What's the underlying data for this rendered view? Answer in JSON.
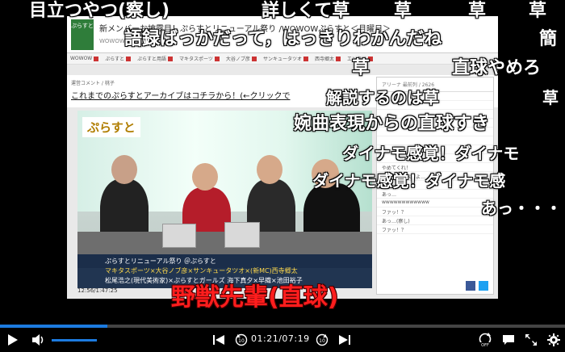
{
  "page": {
    "headline": "新メンバーお披露目！ぷらすとリニューアル祭り /WOWOWぷらすと＜月曜日＞",
    "site_logo": "ぷらすと",
    "subline": "WOWOWぷらすと",
    "nav": [
      "WOWOW",
      "ぷらすと",
      "ぷらすと用語",
      "マキタスポーツ",
      "大谷ノブ彦",
      "サンキュータツオ",
      "西寺郷太",
      "エンタメ"
    ],
    "ops_label": "運営コメント / 桃子",
    "archive_link": "これまでのぷらすとアーカイブはコチラから！(←クリックで",
    "show_logo": "ぷらすと",
    "caption_line1": "ぷらすとリニューアル祭り",
    "caption_line1b": "＠ぷらすと",
    "caption_line2": "マキタスポーツ×大谷ノブ彦×サンキュータツオ×(新MC)西寺郷太",
    "caption_line3": "松尾浩之(現代美術家)×ぷらすとガールズ 海下真夕×早織×池田裕子",
    "timecode": "12:56/1:47:25",
    "chat_header": "アリーナ 最前列 / 2626",
    "chat_lines": [
      "",
      "",
      "",
      "",
      "",
      "",
      "",
      "",
      "やめてくれ！",
      "やべぇよやべぇよ…",
      "ファッ！？",
      "あっ…",
      "wwwwwwwwwwww",
      "ファッ！？",
      "あっ…(察し)",
      "ファッ！？"
    ]
  },
  "comments": [
    {
      "text": "目立つやつ(察し)",
      "cls": "c26"
    },
    {
      "text": "詳しくて草",
      "cls": "c26"
    },
    {
      "text": "草",
      "cls": "c26"
    },
    {
      "text": "草",
      "cls": "c26"
    },
    {
      "text": "草",
      "cls": "c26"
    },
    {
      "text": "語録ばっかだって，はっきりわかんだね",
      "cls": "c26"
    },
    {
      "text": "簡",
      "cls": "c26"
    },
    {
      "text": "草",
      "cls": "c26"
    },
    {
      "text": "直球やめろ",
      "cls": "c26"
    },
    {
      "text": "解説するのは草",
      "cls": "c20"
    },
    {
      "text": "草",
      "cls": "c20"
    },
    {
      "text": "婉曲表現からの直球すき",
      "cls": "c26"
    },
    {
      "text": "ダイナモ感覚！ダイナモ",
      "cls": "c20"
    },
    {
      "text": "ダイナモ感覚！ダイナモ感",
      "cls": "c20"
    },
    {
      "text": "あっ・・・",
      "cls": "c20"
    },
    {
      "text": "野獣先輩(直球)",
      "cls": "red"
    }
  ],
  "player": {
    "time_display": "01:21/07:19",
    "progress": 0.19,
    "volume": 1.0,
    "accent_color": "#1c7be0"
  }
}
